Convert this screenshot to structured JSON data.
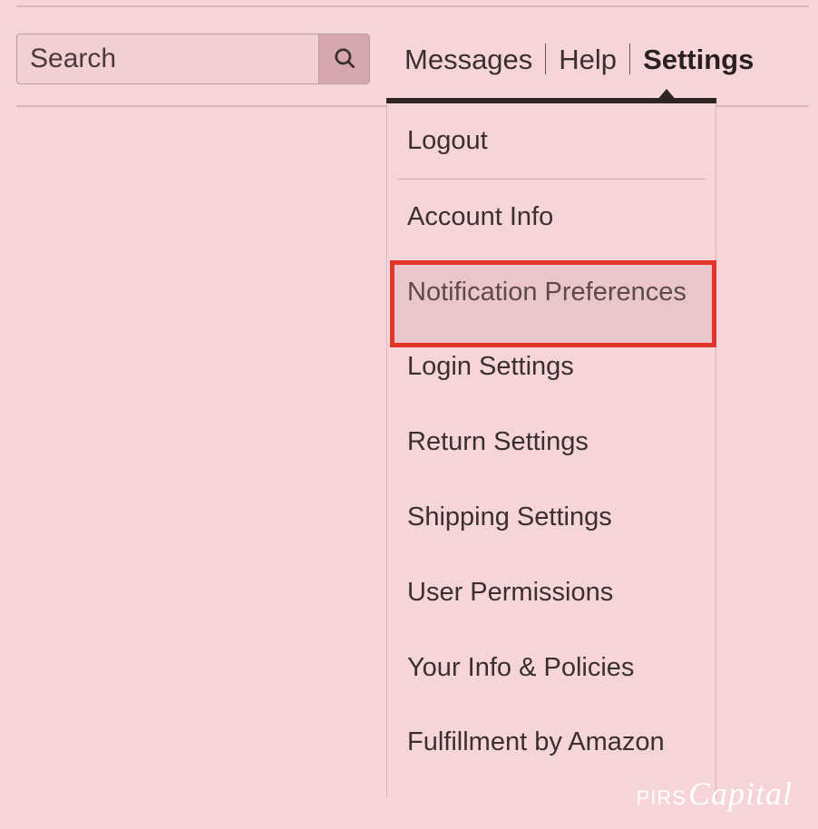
{
  "search": {
    "placeholder": "Search"
  },
  "nav": {
    "messages": "Messages",
    "help": "Help",
    "settings": "Settings"
  },
  "dropdown": {
    "logout": "Logout",
    "account_info": "Account Info",
    "notification_preferences": "Notification Preferences",
    "login_settings": "Login Settings",
    "return_settings": "Return Settings",
    "shipping_settings": "Shipping Settings",
    "user_permissions": "User Permissions",
    "your_info_policies": "Your Info & Policies",
    "fulfillment_by_amazon": "Fulfillment by Amazon"
  },
  "watermark": {
    "pirs": "PIRS",
    "capital": "Capital"
  },
  "colors": {
    "background": "#f6d5d9",
    "highlight_border": "#e2352a",
    "menu_bar": "#2f2324"
  }
}
